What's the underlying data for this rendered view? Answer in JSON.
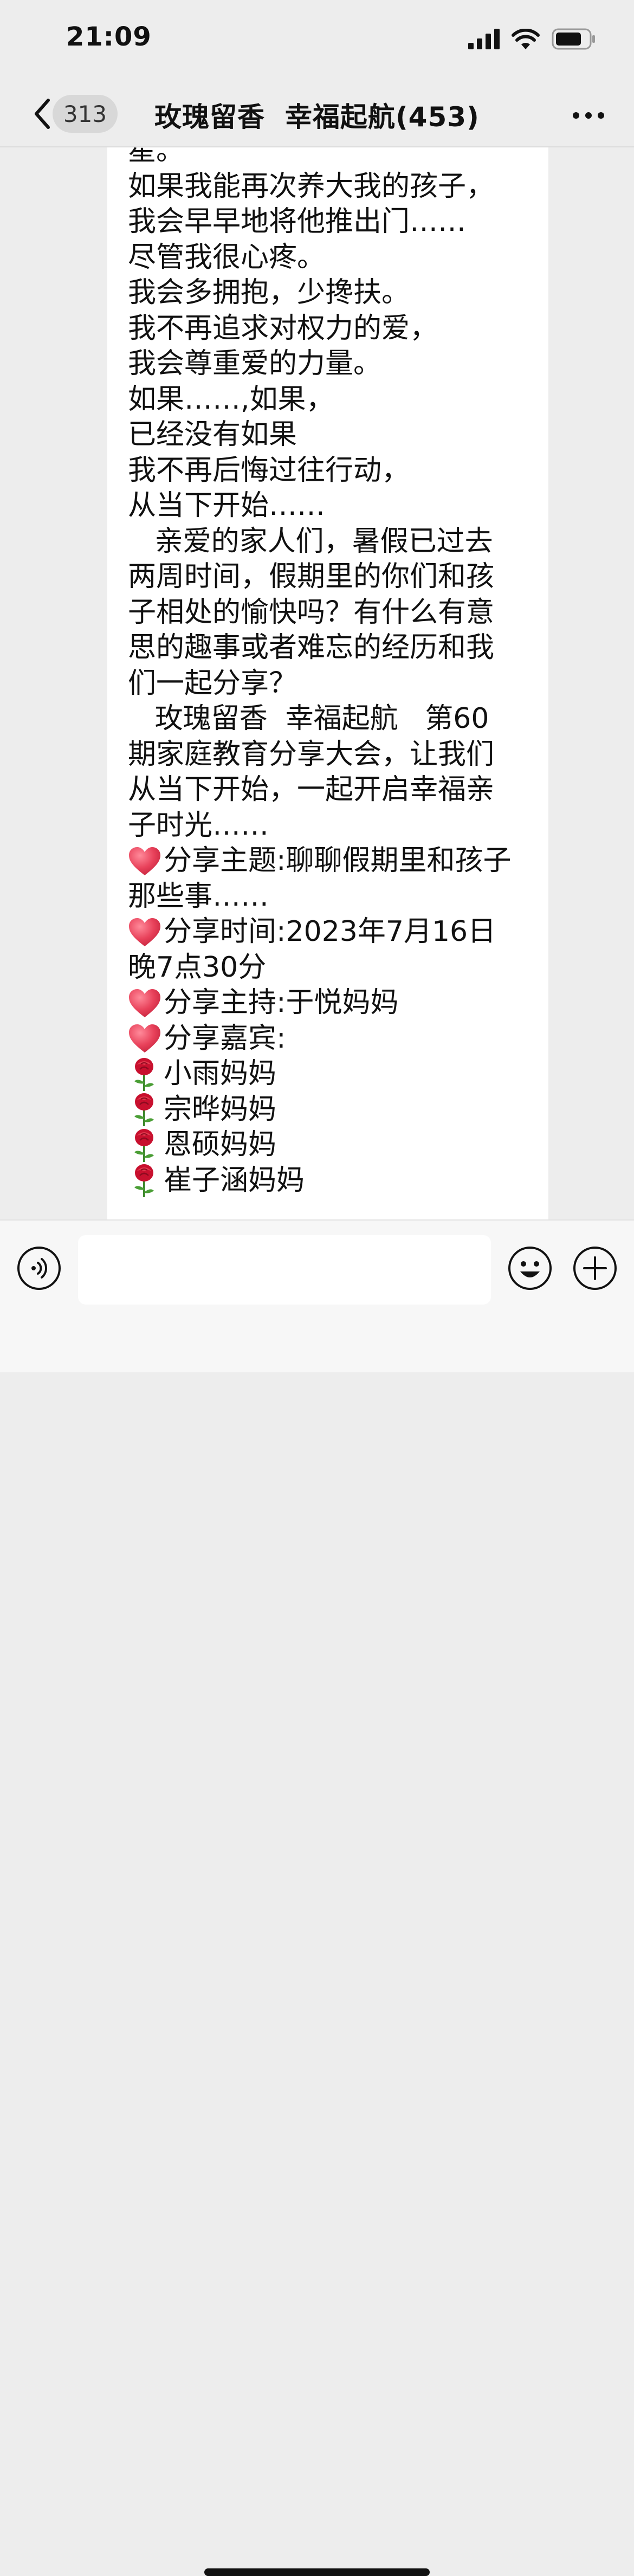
{
  "status_bar": {
    "time": "21:09",
    "icons": [
      "signal-icon",
      "wifi-icon",
      "battery-icon"
    ]
  },
  "nav": {
    "back_icon": "chevron-left-icon",
    "unread_count": "313",
    "title": "玫瑰留香  幸福起航(453)",
    "more_icon": "more-dots-icon"
  },
  "message": {
    "lines": [
      {
        "type": "text",
        "text": "星。"
      },
      {
        "type": "text",
        "text": "如果我能再次养大我的孩子，"
      },
      {
        "type": "text",
        "text": "我会早早地将他推出门……"
      },
      {
        "type": "text",
        "text": "尽管我很心疼。"
      },
      {
        "type": "text",
        "text": "我会多拥抱，少搀扶。"
      },
      {
        "type": "text",
        "text": "我不再追求对权力的爱，"
      },
      {
        "type": "text",
        "text": "我会尊重爱的力量。"
      },
      {
        "type": "text",
        "text": "如果……,如果，"
      },
      {
        "type": "text",
        "text": "已经没有如果"
      },
      {
        "type": "text",
        "text": "我不再后悔过往行动，"
      },
      {
        "type": "text",
        "text": "从当下开始……"
      },
      {
        "type": "text",
        "text": "   亲爱的家人们，暑假已过去"
      },
      {
        "type": "text",
        "text": "两周时间，假期里的你们和孩"
      },
      {
        "type": "text",
        "text": "子相处的愉快吗？有什么有意"
      },
      {
        "type": "text",
        "text": "思的趣事或者难忘的经历和我"
      },
      {
        "type": "text",
        "text": "们一起分享？"
      },
      {
        "type": "text",
        "text": "   玫瑰留香  幸福起航   第60"
      },
      {
        "type": "text",
        "text": "期家庭教育分享大会，让我们"
      },
      {
        "type": "text",
        "text": "从当下开始，一起开启幸福亲"
      },
      {
        "type": "text",
        "text": "子时光……"
      },
      {
        "type": "heart",
        "text": "分享主题:聊聊假期里和孩子"
      },
      {
        "type": "text",
        "text": "那些事……"
      },
      {
        "type": "heart",
        "text": "分享时间:2023年7月16日"
      },
      {
        "type": "text",
        "text": "晚7点30分"
      },
      {
        "type": "heart",
        "text": "分享主持:于悦妈妈"
      },
      {
        "type": "heart",
        "text": "分享嘉宾:"
      },
      {
        "type": "rose",
        "text": "小雨妈妈"
      },
      {
        "type": "rose",
        "text": "宗晔妈妈"
      },
      {
        "type": "rose",
        "text": "恩硕妈妈"
      },
      {
        "type": "rose",
        "text": "崔子涵妈妈"
      }
    ]
  },
  "input_bar": {
    "voice_icon": "voice-icon",
    "input_value": "",
    "emoji_icon": "emoji-icon",
    "plus_icon": "plus-icon"
  },
  "colors": {
    "background": "#ededed",
    "bubble": "#ffffff",
    "heart": "#e8415a",
    "rose": "#c8102e"
  }
}
